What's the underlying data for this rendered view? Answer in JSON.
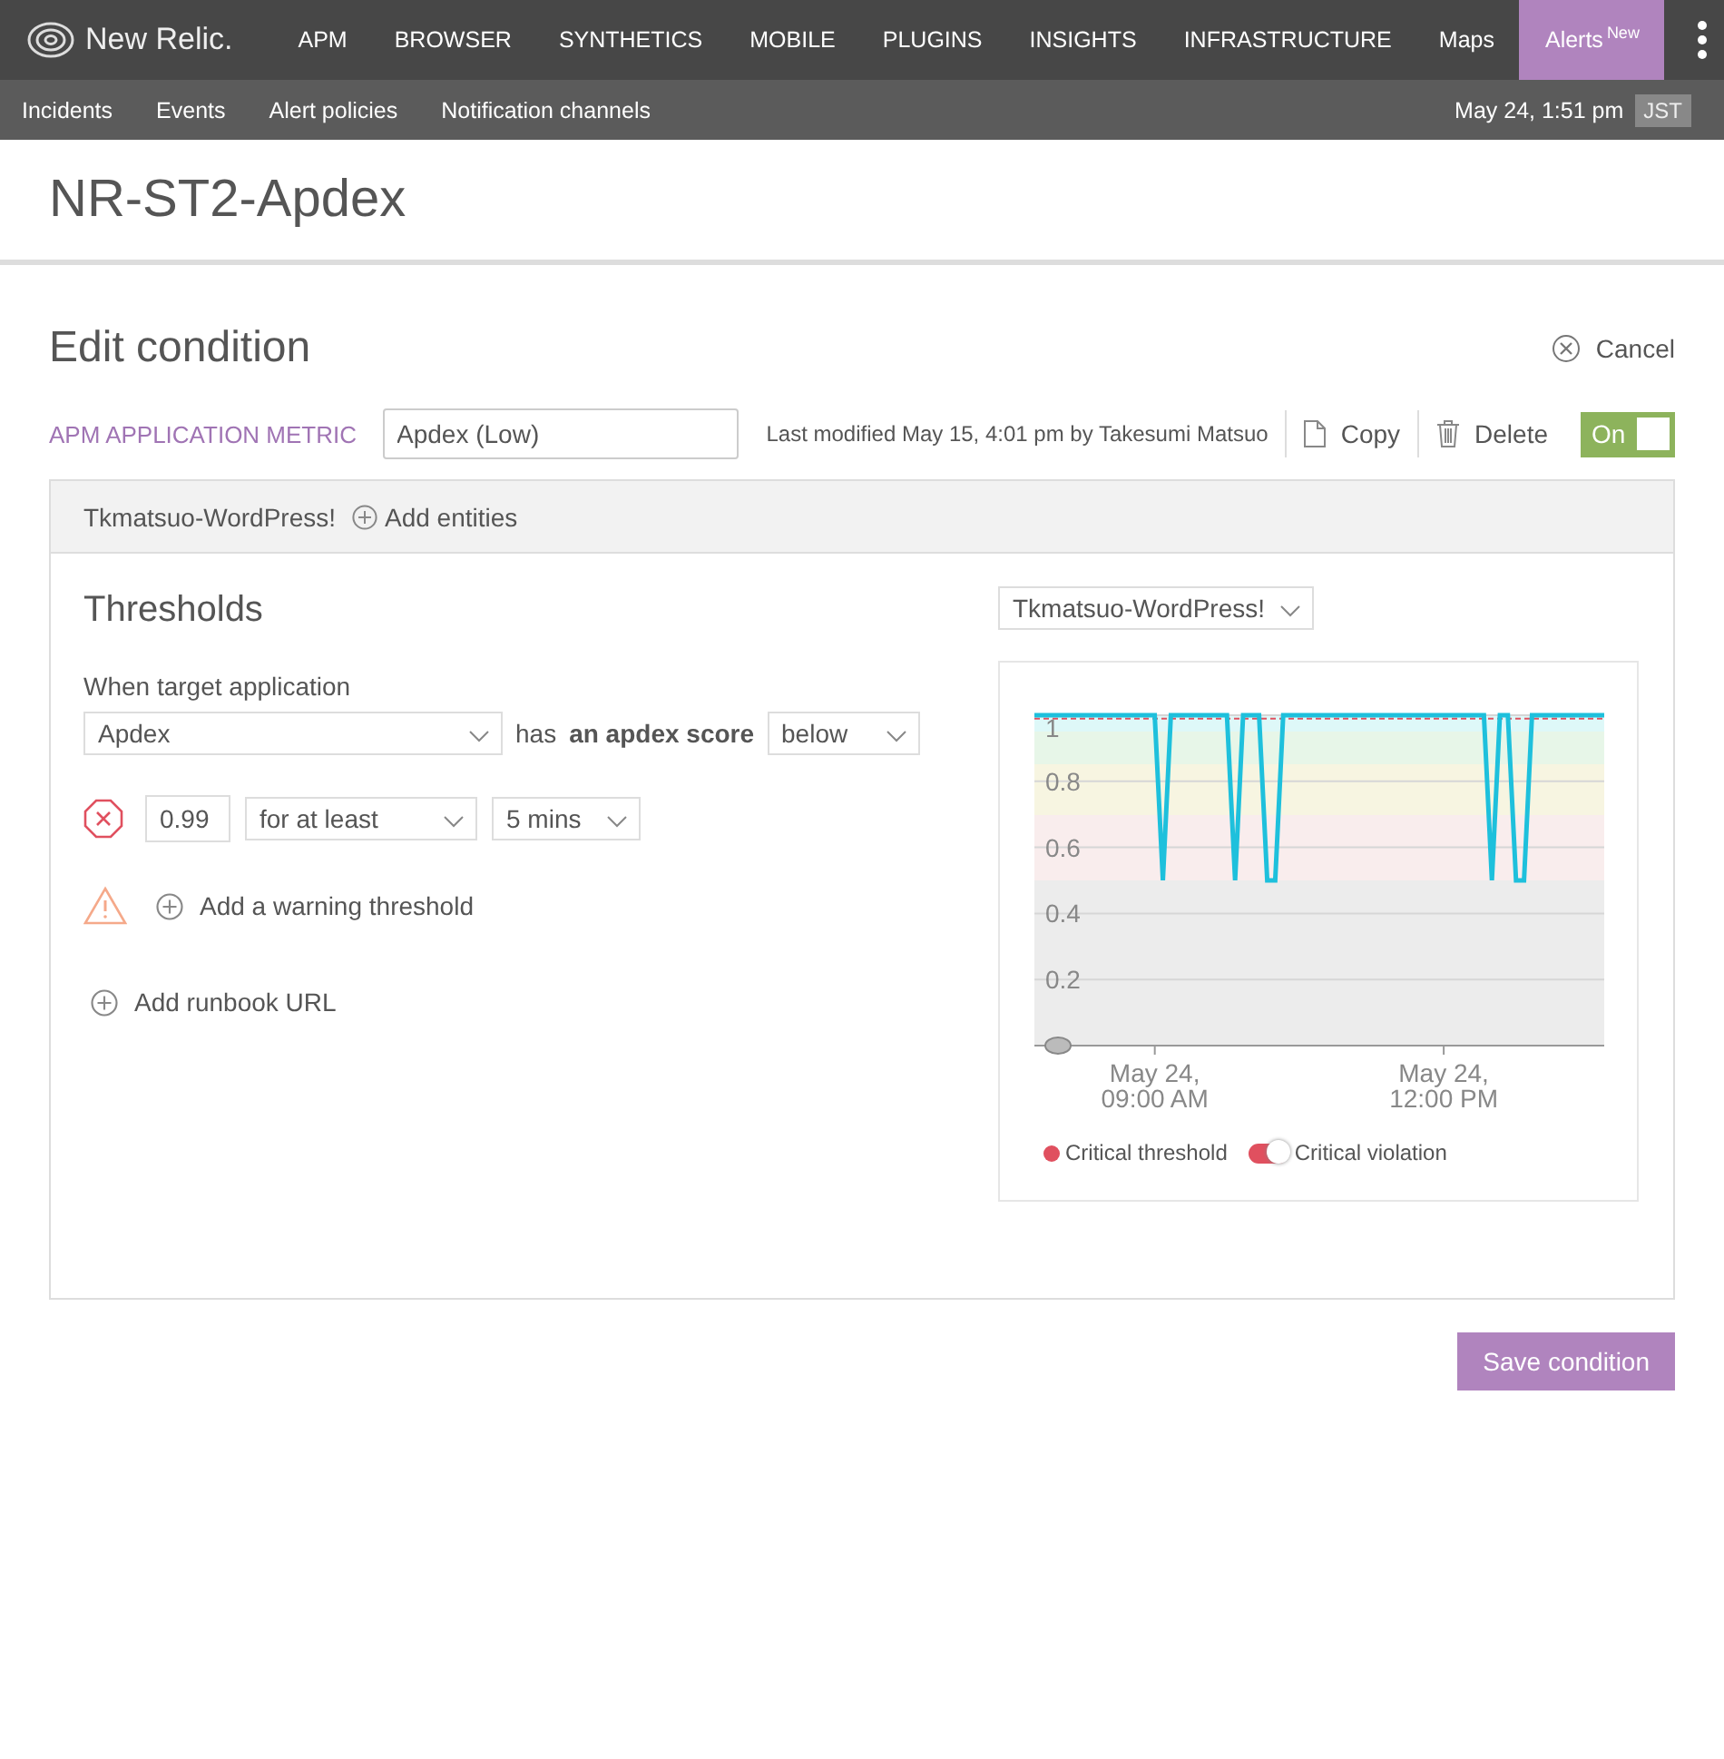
{
  "top_nav": {
    "logo": "New Relic.",
    "items": [
      {
        "label": "APM",
        "selected": false
      },
      {
        "label": "BROWSER",
        "selected": false
      },
      {
        "label": "SYNTHETICS",
        "selected": false
      },
      {
        "label": "MOBILE",
        "selected": false
      },
      {
        "label": "PLUGINS",
        "selected": false
      },
      {
        "label": "INSIGHTS",
        "selected": false
      },
      {
        "label": "INFRASTRUCTURE",
        "selected": false
      },
      {
        "label": "Maps",
        "selected": false
      },
      {
        "label": "Alerts",
        "badge": "New",
        "selected": true
      }
    ]
  },
  "sub_nav": {
    "items": [
      "Incidents",
      "Events",
      "Alert policies",
      "Notification channels"
    ],
    "datetime": "May 24, 1:51 pm",
    "timezone": "JST"
  },
  "page_title": "NR-ST2-Apdex",
  "edit": {
    "heading": "Edit condition",
    "cancel": "Cancel",
    "metric_label": "APM APPLICATION METRIC",
    "name_value": "Apdex (Low)",
    "last_modified": "Last modified May 15, 4:01 pm by Takesumi Matsuo",
    "copy": "Copy",
    "delete": "Delete",
    "toggle": {
      "label": "On",
      "on": true
    }
  },
  "entities": {
    "name": "Tkmatsuo-WordPress!",
    "add": "Add entities"
  },
  "thresholds": {
    "heading": "Thresholds",
    "target_label": "When target application",
    "metric_select": "Apdex",
    "has": "has",
    "condition_text": "an apdex score",
    "operator_select": "below",
    "critical": {
      "value": "0.99",
      "duration_op": "for at least",
      "duration": "5 mins"
    },
    "warning_add": "Add a warning threshold",
    "runbook_add": "Add runbook URL"
  },
  "chart_panel": {
    "entity_select": "Tkmatsuo-WordPress!",
    "chart_data": {
      "type": "line",
      "ylim": [
        0,
        1
      ],
      "grid": true,
      "yticks": [
        0.2,
        0.4,
        0.6,
        0.8,
        1
      ],
      "categories": [
        null,
        null,
        null,
        null,
        null,
        null,
        null,
        null,
        null,
        null,
        null,
        null,
        null,
        null,
        null,
        "May 24, 09:00 AM",
        null,
        null,
        null,
        null,
        null,
        null,
        null,
        null,
        null,
        null,
        null,
        null,
        null,
        null,
        null,
        null,
        null,
        null,
        null,
        null,
        null,
        null,
        null,
        null,
        null,
        null,
        null,
        null,
        null,
        null,
        null,
        null,
        null,
        null,
        null,
        "May 24, 12:00 PM",
        null,
        null,
        null,
        null,
        null,
        null,
        null,
        null,
        null,
        null,
        null,
        null,
        null,
        null,
        null,
        null,
        null,
        null,
        null,
        null
      ],
      "series": [
        {
          "color": "#1ec0dc",
          "values": [
            1,
            1,
            1,
            1,
            1,
            1,
            1,
            1,
            1,
            1,
            1,
            1,
            1,
            1,
            1,
            1,
            0.5,
            1,
            1,
            1,
            1,
            1,
            1,
            1,
            1,
            0.5,
            1,
            1,
            1,
            0.5,
            0.5,
            1,
            1,
            1,
            1,
            1,
            1,
            1,
            1,
            1,
            1,
            1,
            1,
            1,
            1,
            1,
            1,
            1,
            1,
            1,
            1,
            1,
            1,
            1,
            1,
            1,
            1,
            0.5,
            1,
            1,
            0.5,
            0.5,
            1,
            1,
            1,
            1,
            1,
            1,
            1,
            1,
            1,
            1
          ]
        }
      ]
    },
    "legend": [
      {
        "label": "Critical threshold",
        "kind": "dot",
        "color": "#e0505f"
      },
      {
        "label": "Critical violation",
        "kind": "toggle",
        "color": "#e0505f",
        "on": true
      }
    ]
  },
  "save": "Save condition"
}
